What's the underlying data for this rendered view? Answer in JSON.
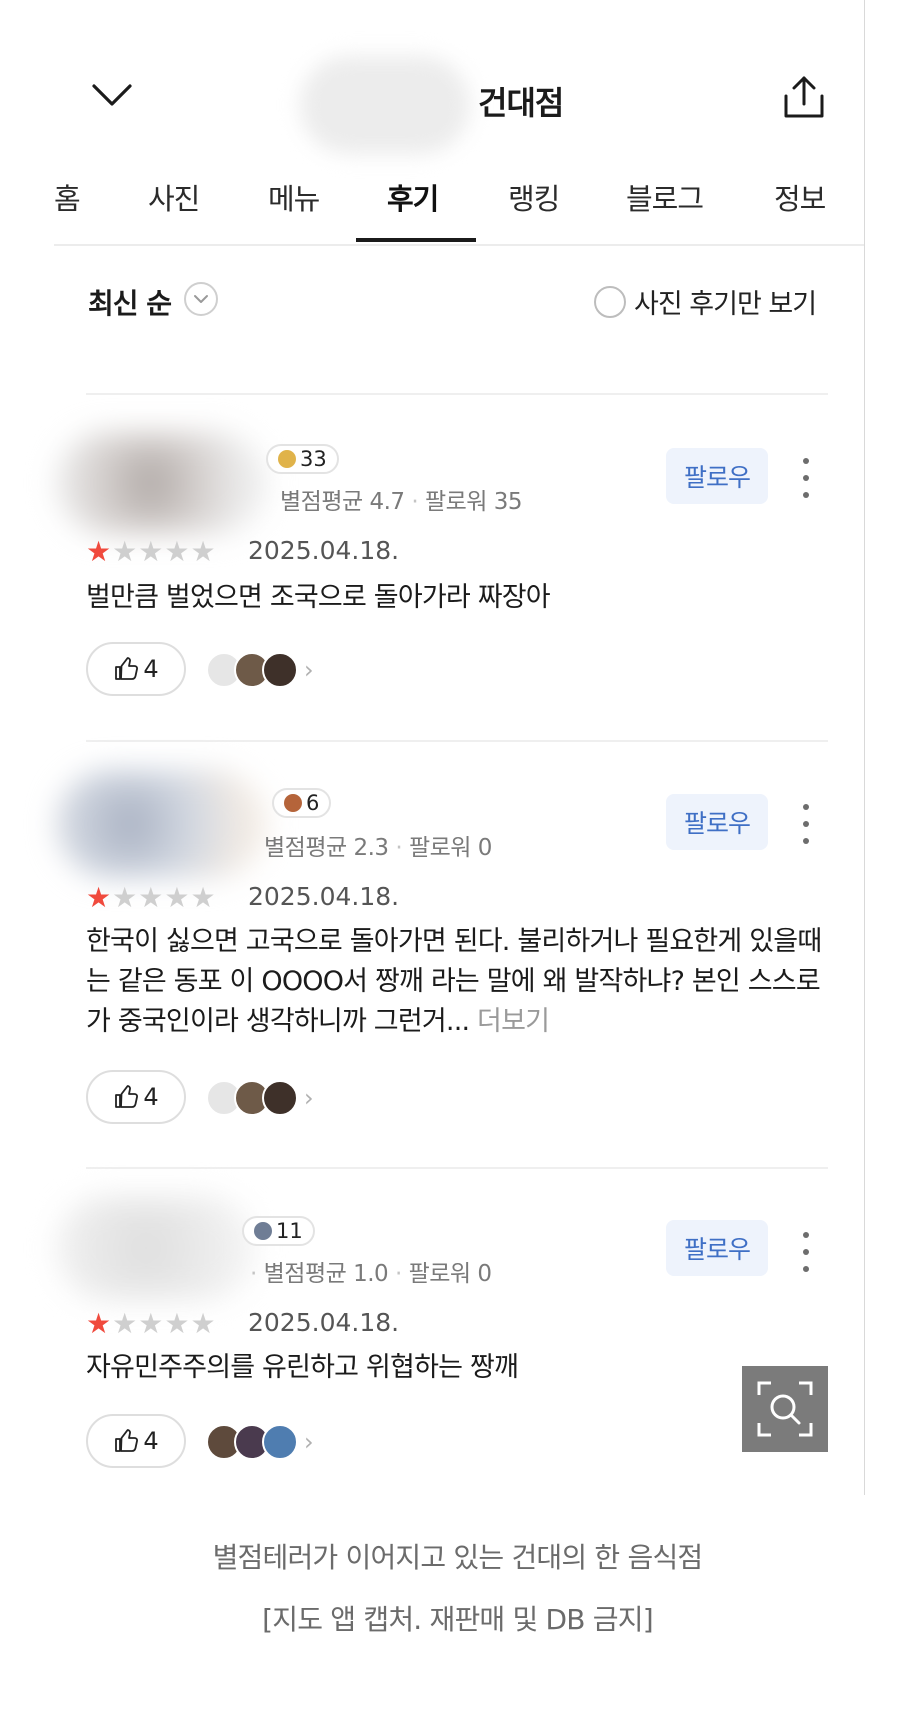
{
  "header": {
    "title": "건대점",
    "collapse_icon": "chevron-down-icon",
    "share_icon": "share-upload-icon"
  },
  "tabs": [
    {
      "label": "홈"
    },
    {
      "label": "사진"
    },
    {
      "label": "메뉴"
    },
    {
      "label": "후기",
      "active": true
    },
    {
      "label": "랭킹"
    },
    {
      "label": "블로그"
    },
    {
      "label": "정보"
    }
  ],
  "filters": {
    "sort_label": "최신 순",
    "photo_only_label": "사진 후기만 보기"
  },
  "reviews": [
    {
      "badge_count": "33",
      "badge_color": "#e0b34a",
      "meta_rating": "별점평균 4.7",
      "meta_followers": "팔로워 35",
      "follow_label": "팔로우",
      "stars": 1,
      "date": "2025.04.18.",
      "text": "벌만큼 벌었으면 조국으로 돌아가라 짜장아",
      "more_label": "",
      "likes": "4"
    },
    {
      "badge_count": "6",
      "badge_color": "#b5643a",
      "meta_rating": "별점평균 2.3",
      "meta_followers": "팔로워 0",
      "follow_label": "팔로우",
      "stars": 1,
      "date": "2025.04.18.",
      "text": "한국이 싫으면 고국으로 돌아가면 된다. 불리하거나 필요한게 있을때는 같은 동포 이 OOOO서 짱깨 라는 말에 왜 발작하냐? 본인 스스로가 중국인이라 생각하니까 그런거... ",
      "more_label": "더보기",
      "likes": "4"
    },
    {
      "badge_count": "11",
      "badge_color": "#6f7d95",
      "meta_rating": "별점평균 1.0",
      "meta_followers": "팔로워 0",
      "follow_label": "팔로우",
      "stars": 1,
      "date": "2025.04.18.",
      "text": "자유민주주의를 유린하고 위협하는 짱깨",
      "more_label": "",
      "likes": "4"
    }
  ],
  "caption": {
    "line1": "별점테러가 이어지고 있는 건대의 한 음식점",
    "line2": "[지도 앱 캡처. 재판매 및 DB 금지]"
  },
  "colors": {
    "accent_blue": "#3f6fc5",
    "follow_bg": "#eef3fc",
    "star_on": "#f04a3d",
    "star_off": "#cfcfcf"
  }
}
